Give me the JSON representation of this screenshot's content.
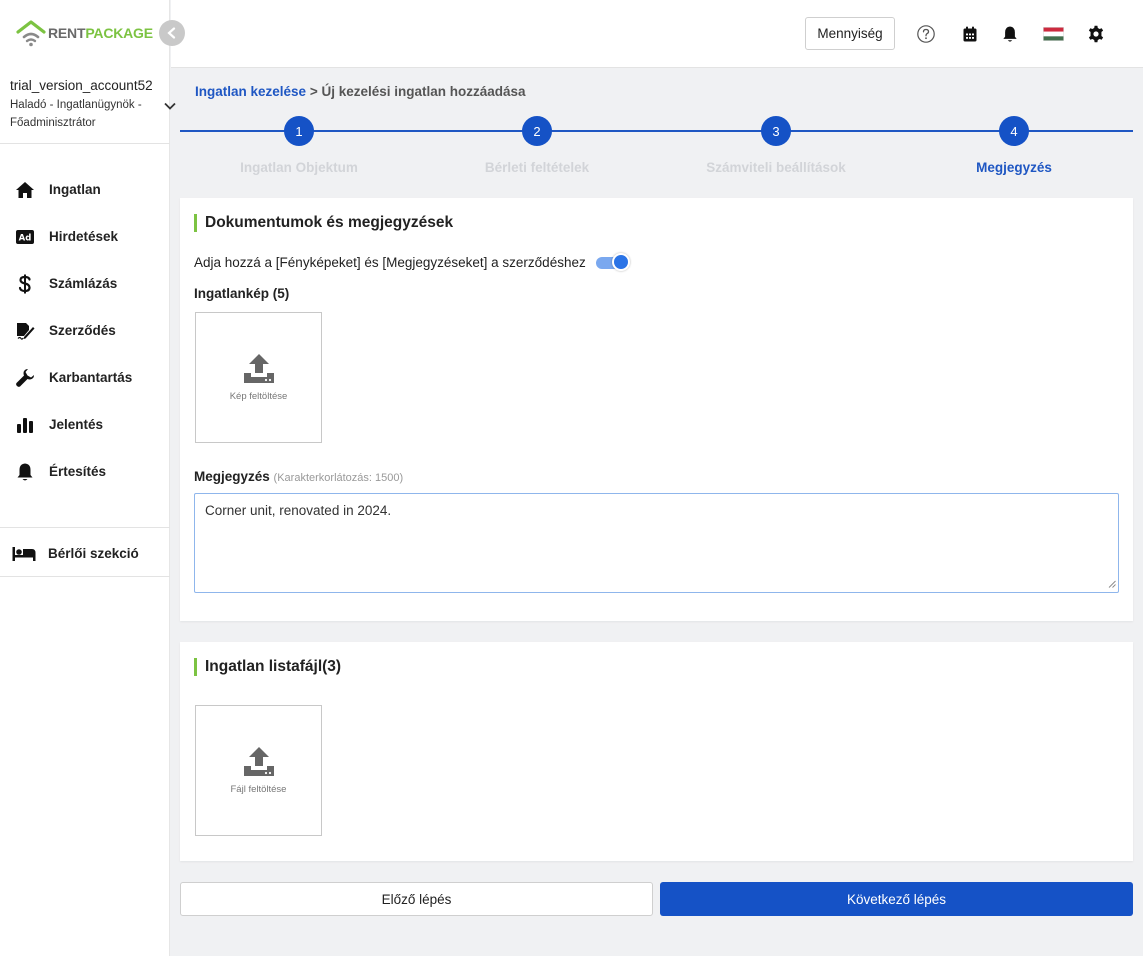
{
  "brand": {
    "part1": "RENT",
    "part2": "PACKAGE"
  },
  "account": {
    "name": "trial_version_account52",
    "role": "Haladó - Ingatlanügynök - Főadminisztrátor"
  },
  "sidebar": {
    "items": [
      {
        "label": "Ingatlan",
        "icon": "home-icon"
      },
      {
        "label": "Hirdetések",
        "icon": "ad-icon"
      },
      {
        "label": "Számlázás",
        "icon": "dollar-icon"
      },
      {
        "label": "Szerződés",
        "icon": "contract-icon"
      },
      {
        "label": "Karbantartás",
        "icon": "wrench-icon"
      },
      {
        "label": "Jelentés",
        "icon": "bar-chart-icon"
      },
      {
        "label": "Értesítés",
        "icon": "bell-icon"
      }
    ],
    "tenant": {
      "label": "Bérlői szekció",
      "icon": "bed-icon"
    }
  },
  "header": {
    "quantity_button": "Mennyiség",
    "icons": [
      "help-icon",
      "calendar-icon",
      "bell-icon",
      "hungary-flag-icon",
      "gear-icon"
    ]
  },
  "breadcrumb": {
    "root": "Ingatlan kezelése",
    "separator": ">",
    "current": "Új kezelési ingatlan hozzáadása"
  },
  "stepper": {
    "steps": [
      {
        "number": "1",
        "label": "Ingatlan Objektum"
      },
      {
        "number": "2",
        "label": "Bérleti feltételek"
      },
      {
        "number": "3",
        "label": "Számviteli beállítások"
      },
      {
        "number": "4",
        "label": "Megjegyzés"
      }
    ],
    "active_step": 4
  },
  "documents_card": {
    "title": "Dokumentumok és megjegyzések",
    "toggle_label": "Adja hozzá a [Fényképeket] és [Megjegyzéseket] a szerződéshez",
    "toggle_on": true,
    "photos_label": "Ingatlankép (5)",
    "photo_upload_text": "Kép feltöltése",
    "note_label": "Megjegyzés",
    "note_hint": "(Karakterkorlátozás: 1500)",
    "note_value": "Corner unit, renovated in 2024."
  },
  "listing_card": {
    "title": "Ingatlan listafájl(3)",
    "file_upload_text": "Fájl feltöltése"
  },
  "buttons": {
    "prev": "Előző lépés",
    "next": "Következő lépés"
  },
  "colors": {
    "primary": "#1552c6",
    "accent_green": "#7cc342",
    "link": "#1f57c3"
  }
}
